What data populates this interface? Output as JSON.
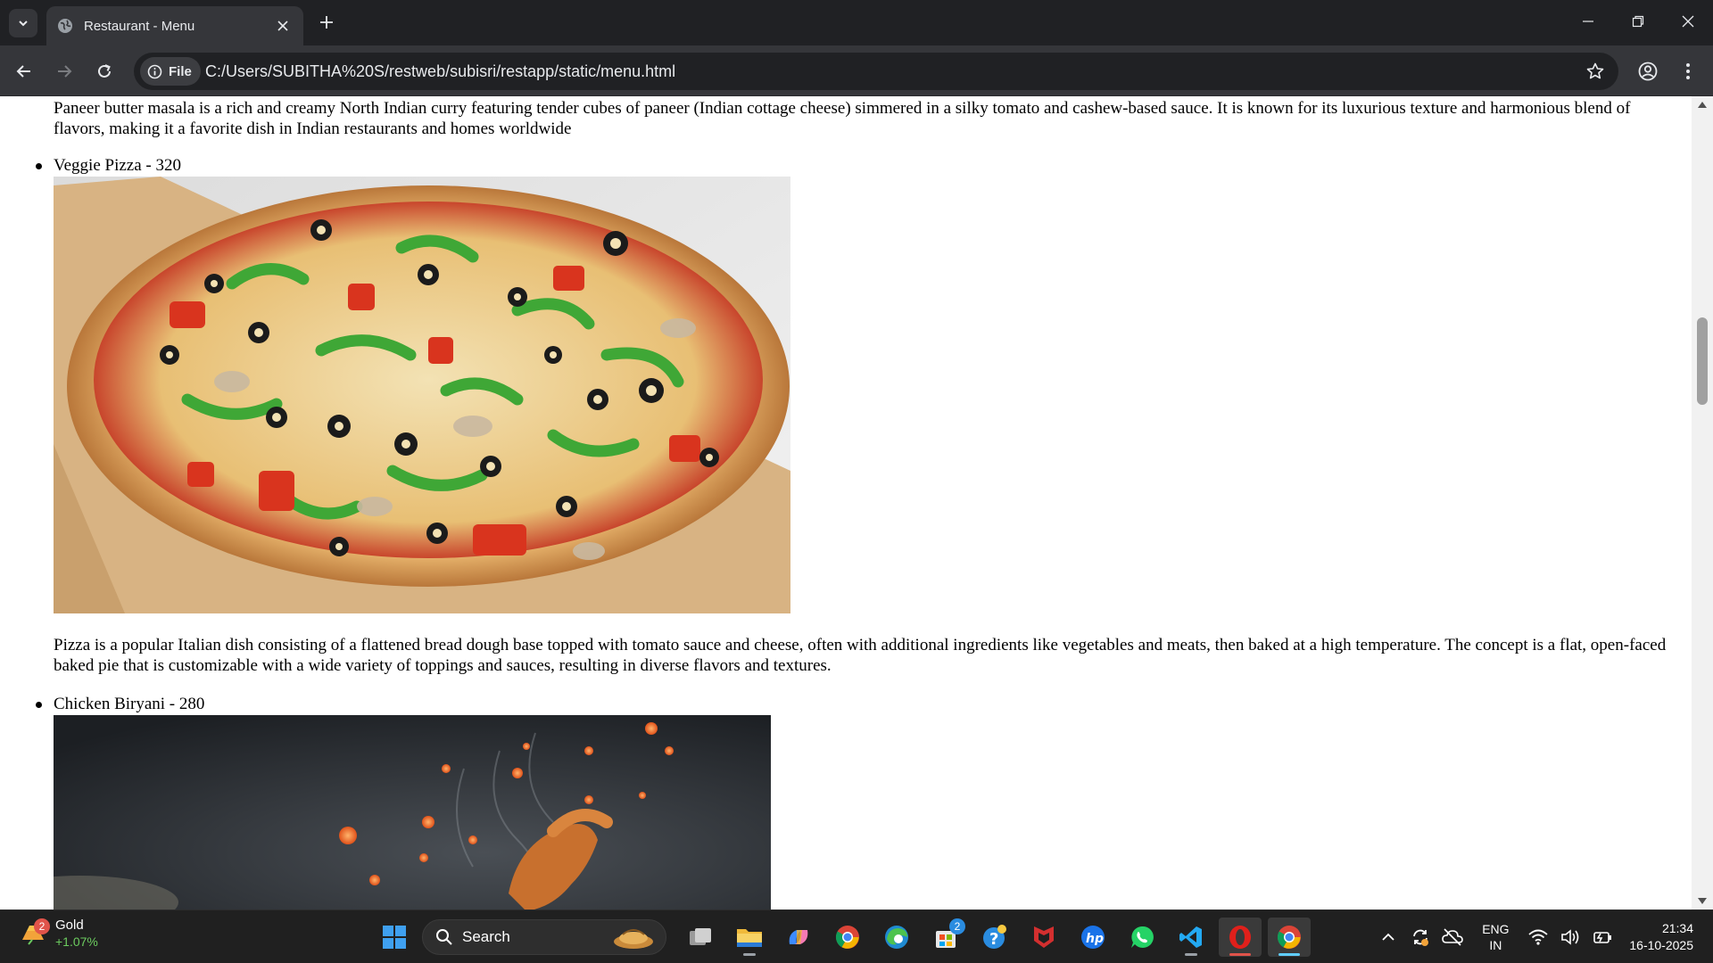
{
  "browser": {
    "tab_title": "Restaurant - Menu",
    "site_chip_label": "File",
    "url": "C:/Users/SUBITHA%20S/restweb/subisri/restapp/static/menu.html"
  },
  "menu": {
    "paneer_description": "Paneer butter masala is a rich and creamy North Indian curry featuring tender cubes of paneer (Indian cottage cheese) simmered in a silky tomato and cashew-based sauce. It is known for its luxurious texture and harmonious blend of flavors, making it a favorite dish in Indian restaurants and homes worldwide",
    "items": [
      {
        "label": "Veggie Pizza - 320",
        "description": "Pizza is a popular Italian dish consisting of a flattened bread dough base topped with tomato sauce and cheese, often with additional ingredients like vegetables and meats, then baked at a high temperature. The concept is a flat, open-faced baked pie that is customizable with a wide variety of toppings and sauces, resulting in diverse flavors and textures."
      },
      {
        "label": "Chicken Biryani - 280"
      }
    ]
  },
  "taskbar": {
    "widget_title": "Gold",
    "widget_change": "+1.07%",
    "widget_badge": "2",
    "search_label": "Search",
    "store_badge": "2",
    "language_line1": "ENG",
    "language_line2": "IN",
    "time": "21:34",
    "date": "16-10-2025"
  },
  "colors": {
    "titlebar_bg": "#202124",
    "toolbar_bg": "#35363a",
    "taskbar_bg": "#202020",
    "page_bg": "#ffffff"
  }
}
